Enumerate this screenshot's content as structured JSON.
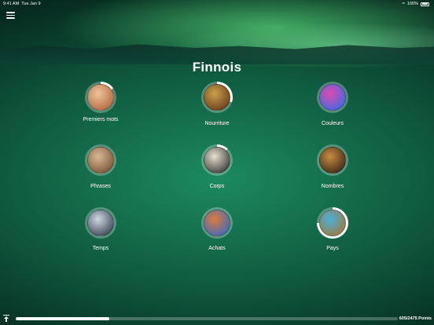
{
  "status_bar": {
    "time": "9:41 AM",
    "date": "Tue Jan 9",
    "battery_percent": "100%"
  },
  "header": {
    "title": "Finnois"
  },
  "topics": [
    {
      "label": "Premiers mots",
      "progress": 0.15,
      "colors": [
        "#f0c49a",
        "#b06840"
      ]
    },
    {
      "label": "Nourriture",
      "progress": 0.3,
      "colors": [
        "#c9a24a",
        "#6b3a1c"
      ]
    },
    {
      "label": "Couleurs",
      "progress": 0.0,
      "colors": [
        "#e04ab0",
        "#3a6be0"
      ]
    },
    {
      "label": "Phrases",
      "progress": 0.0,
      "colors": [
        "#d9b995",
        "#7a5434"
      ]
    },
    {
      "label": "Corps",
      "progress": 0.12,
      "colors": [
        "#e8e0d0",
        "#3a3a3a"
      ]
    },
    {
      "label": "Nombres",
      "progress": 0.0,
      "colors": [
        "#c98a40",
        "#3a2a1a"
      ]
    },
    {
      "label": "Temps",
      "progress": 0.0,
      "colors": [
        "#cfd7e0",
        "#3a4554"
      ]
    },
    {
      "label": "Achats",
      "progress": 0.0,
      "colors": [
        "#e07a3a",
        "#3a6bc0"
      ]
    },
    {
      "label": "Pays",
      "progress": 0.75,
      "colors": [
        "#4ab0e0",
        "#a07a3a"
      ]
    }
  ],
  "footer": {
    "points_label": "605/2475 Points",
    "progress": 0.244
  }
}
